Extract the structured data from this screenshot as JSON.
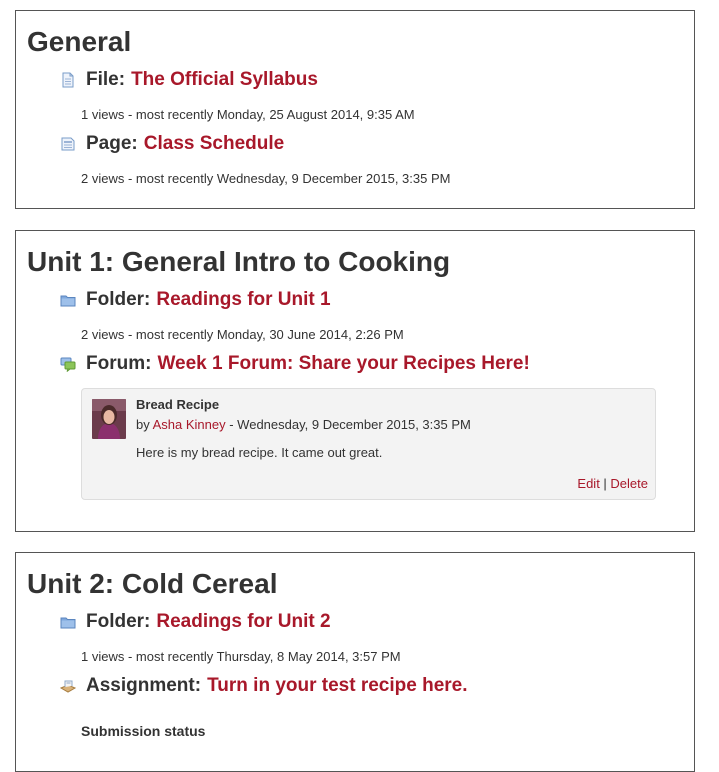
{
  "sections": [
    {
      "title": "General",
      "activities": [
        {
          "type": "File:",
          "name": "The Official Syllabus",
          "icon": "file-icon",
          "meta": "1 views - most recently Monday, 25 August 2014, 9:35 AM"
        },
        {
          "type": "Page:",
          "name": "Class Schedule",
          "icon": "page-icon",
          "meta": "2 views - most recently Wednesday, 9 December 2015, 3:35 PM"
        }
      ]
    },
    {
      "title": "Unit 1: General Intro to Cooking",
      "activities": [
        {
          "type": "Folder:",
          "name": "Readings for Unit 1",
          "icon": "folder-icon",
          "meta": "2 views - most recently Monday, 30 June 2014, 2:26 PM"
        },
        {
          "type": "Forum:",
          "name": "Week 1 Forum: Share your Recipes Here!",
          "icon": "forum-icon"
        }
      ],
      "post": {
        "subject": "Bread Recipe",
        "by_prefix": "by ",
        "author": "Asha Kinney",
        "date": " - Wednesday, 9 December 2015, 3:35 PM",
        "text": "Here is my bread recipe. It came out great.",
        "edit": "Edit",
        "separator": " | ",
        "delete": "Delete"
      }
    },
    {
      "title": "Unit 2: Cold Cereal",
      "activities": [
        {
          "type": "Folder:",
          "name": "Readings for Unit 2",
          "icon": "folder-icon",
          "meta": "1 views - most recently Thursday, 8 May 2014, 3:57 PM"
        },
        {
          "type": "Assignment:",
          "name": "Turn in your test recipe here.",
          "icon": "assignment-icon"
        }
      ],
      "submission_status": "Submission status"
    }
  ],
  "colors": {
    "link": "#a8182a",
    "text": "#333333",
    "border": "#555555",
    "post_bg": "#f3f3f3"
  }
}
